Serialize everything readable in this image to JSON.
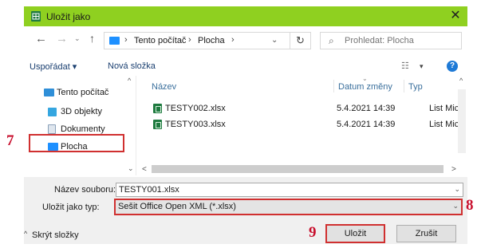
{
  "window": {
    "title": "Uložit jako",
    "close_glyph": "✕",
    "app_icon": "excel-icon"
  },
  "navigation": {
    "back_glyph": "←",
    "forward_glyph": "→",
    "recent_glyph": "⌄",
    "up_glyph": "↑",
    "breadcrumbs": [
      "Tento počítač",
      "Plocha"
    ],
    "separator": "›",
    "dropdown_glyph": "⌄",
    "refresh_glyph": "↻",
    "search": {
      "placeholder": "Prohledat: Plocha",
      "value": "",
      "icon_glyph": "⌕"
    }
  },
  "toolbar": {
    "organize_label": "Uspořádat ▾",
    "new_folder_label": "Nová složka",
    "view_glyph": "☷",
    "view_dropdown_glyph": "▾",
    "help_glyph": "?"
  },
  "sidebar": {
    "items": [
      {
        "label": "Tento počítač",
        "icon": "computer-icon"
      },
      {
        "label": "3D objekty",
        "icon": "cube-icon"
      },
      {
        "label": "Dokumenty",
        "icon": "document-icon"
      },
      {
        "label": "Plocha",
        "icon": "desktop-icon",
        "selected": true
      }
    ],
    "scroll_up_glyph": "^",
    "scroll_down_glyph": "⌄"
  },
  "file_list": {
    "columns": [
      "Název",
      "Datum změny",
      "Typ"
    ],
    "sort_glyph": "⌄",
    "rows": [
      {
        "name": "TESTY002.xlsx",
        "date": "5.4.2021 14:39",
        "type": "List Micro"
      },
      {
        "name": "TESTY003.xlsx",
        "date": "5.4.2021 14:39",
        "type": "List Micro"
      }
    ],
    "scroll_up_glyph": "^",
    "hscroll_left_glyph": "<",
    "hscroll_right_glyph": ">"
  },
  "form": {
    "filename_label": "Název souboru:",
    "filename_value": "TESTY001.xlsx",
    "type_label": "Uložit jako typ:",
    "type_value": "Sešit Office Open XML (*.xlsx)",
    "dropdown_glyph": "⌄"
  },
  "footer": {
    "hide_folders_label": "Skrýt složky",
    "hide_folders_glyph": "^",
    "save_label": "Uložit",
    "cancel_label": "Zrušit"
  },
  "annotations": {
    "step7": "7",
    "step8": "8",
    "step9": "9",
    "highlight_color": "#d03030",
    "number_color": "#c8102e"
  },
  "colors": {
    "titlebar": "#8fd020",
    "accent": "#1e7ad6",
    "excel": "#1f7a40"
  }
}
